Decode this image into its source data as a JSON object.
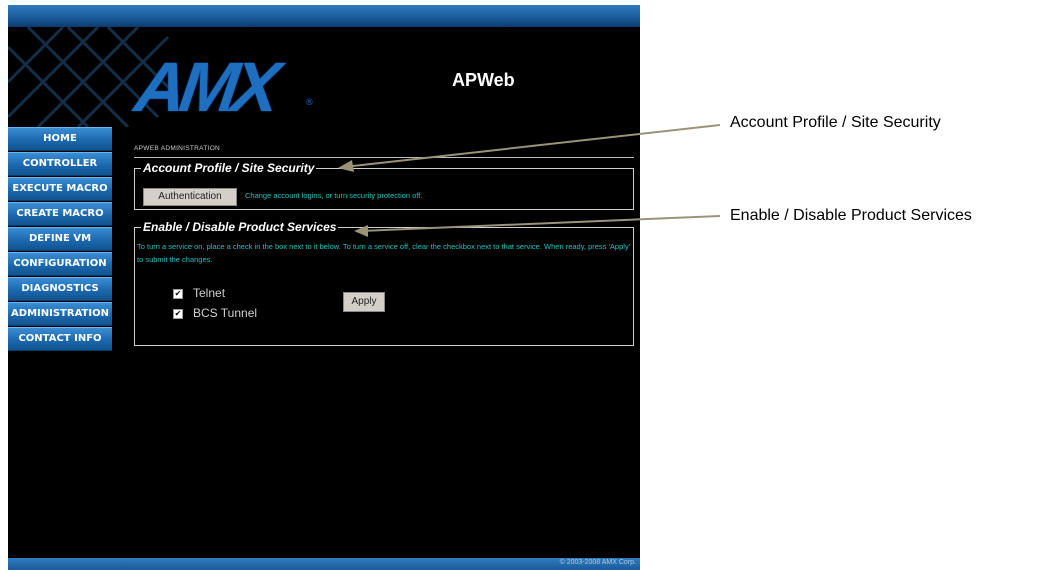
{
  "app": {
    "title": "APWeb",
    "logo": "AMX",
    "logo_reg": "®"
  },
  "nav": {
    "items": [
      {
        "label": "HOME"
      },
      {
        "label": "CONTROLLER"
      },
      {
        "label": "EXECUTE MACRO"
      },
      {
        "label": "CREATE MACRO"
      },
      {
        "label": "DEFINE VM"
      },
      {
        "label": "CONFIGURATION"
      },
      {
        "label": "DIAGNOSTICS"
      },
      {
        "label": "ADMINISTRATION"
      },
      {
        "label": "CONTACT INFO"
      }
    ]
  },
  "breadcrumb": "APWEB ADMINISTRATION",
  "account_section": {
    "title": "Account Profile / Site Security",
    "button": "Authentication",
    "description": "Change account logins, or turn security protection off."
  },
  "services_section": {
    "title": "Enable / Disable Product Services",
    "description": "To turn a service on, place a check in the box next to it below. To turn a service off, clear the checkbox next to that service. When ready, press 'Apply' to submit the changes.",
    "services": [
      {
        "label": "Telnet",
        "checked": true
      },
      {
        "label": "BCS Tunnel",
        "checked": true
      }
    ],
    "apply_button": "Apply"
  },
  "footer": {
    "copyright": "© 2003-2008 AMX Corp."
  },
  "callouts": {
    "account": "Account Profile / Site Security",
    "services": "Enable / Disable Product Services"
  },
  "colors": {
    "accent": "#1f6fc0",
    "description_text": "#22c0c0",
    "background": "#000000"
  }
}
